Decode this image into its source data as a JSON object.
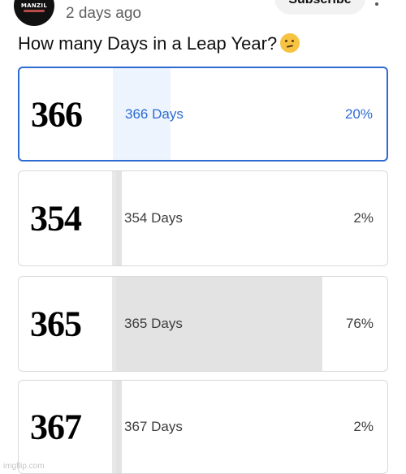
{
  "header": {
    "channel_logo_text": "MANZIL",
    "time_ago": "2 days ago",
    "subscribe_label": "Subscribe"
  },
  "poll": {
    "question": "How many Days in a Leap Year?",
    "question_emoji": "thinking-face",
    "options": [
      {
        "number_image_text": "366",
        "label": "366 Days",
        "percent_text": "20%",
        "percent": 20,
        "selected": true
      },
      {
        "number_image_text": "354",
        "label": "354 Days",
        "percent_text": "2%",
        "percent": 2,
        "selected": false
      },
      {
        "number_image_text": "365",
        "label": "365 Days",
        "percent_text": "76%",
        "percent": 76,
        "selected": false
      },
      {
        "number_image_text": "367",
        "label": "367 Days",
        "percent_text": "2%",
        "percent": 2,
        "selected": false
      }
    ]
  },
  "watermark": "imgflip.com",
  "colors": {
    "selected_accent": "#2d6bd1",
    "selected_fill": "#edf4fd",
    "result_fill": "#e3e3e3"
  }
}
